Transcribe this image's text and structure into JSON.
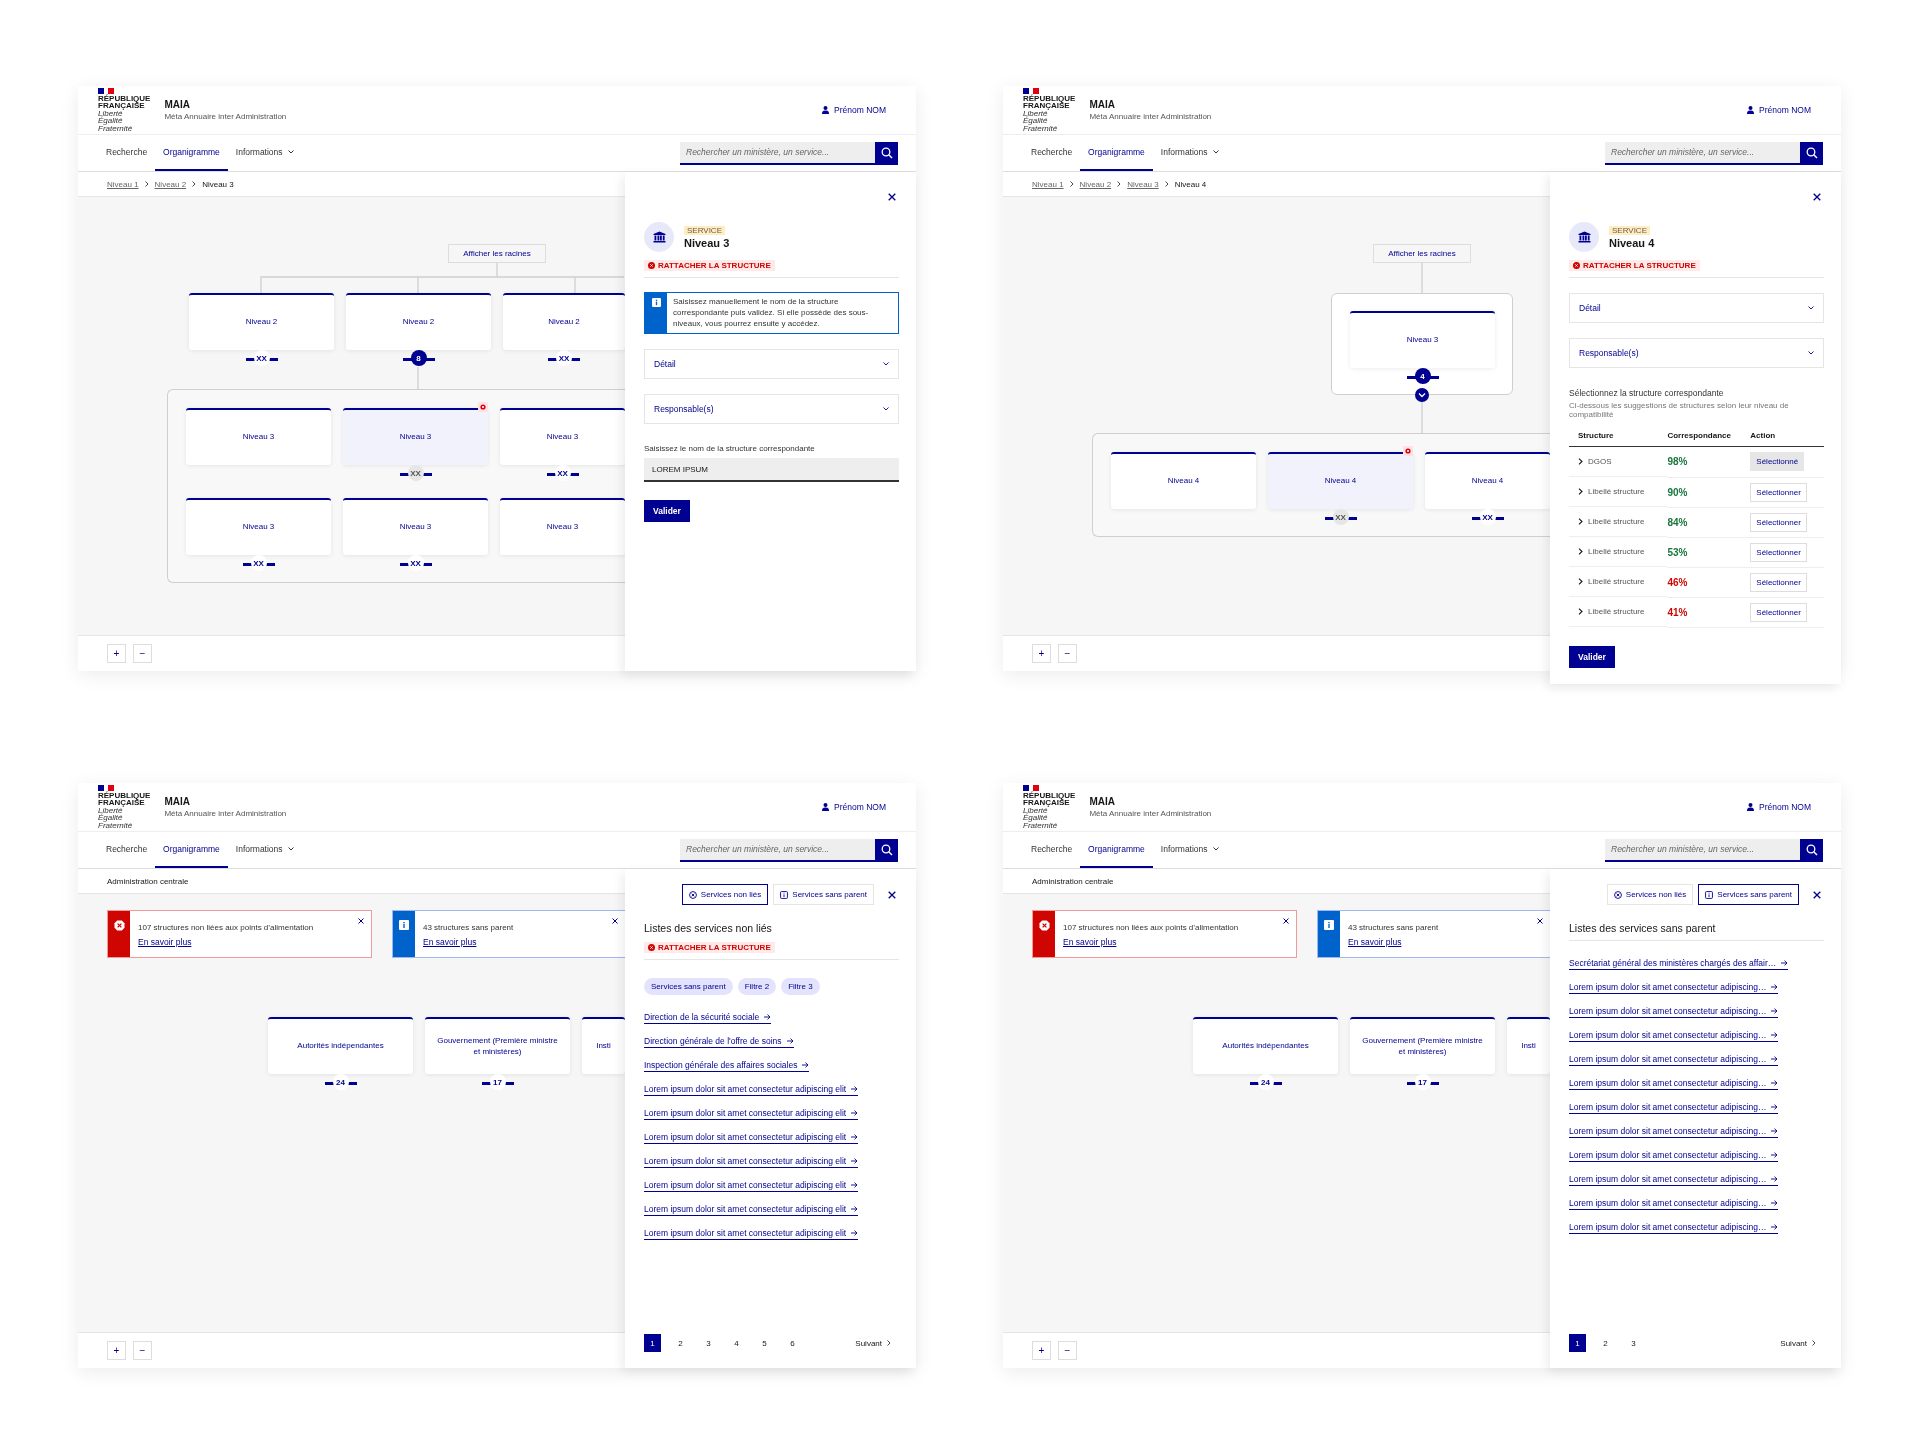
{
  "screens": [
    {
      "header": {
        "logo": [
          "RÉPUBLIQUE",
          "FRANÇAISE"
        ],
        "motto": [
          "Liberté",
          "Égalité",
          "Fraternité"
        ],
        "brand": "MAIA",
        "tagline": "Méta Annuaire inter Administration",
        "user": "Prénom NOM"
      },
      "nav": [
        {
          "label": "Recherche",
          "selected": false
        },
        {
          "label": "Organigramme",
          "selected": true
        },
        {
          "label": "Informations",
          "selected": false,
          "menu": true
        }
      ],
      "search": {
        "placeholder": "Rechercher un ministère, un service..."
      },
      "breadcrumb": [
        {
          "label": "Niveau 1",
          "current": false
        },
        {
          "label": "Niveau 2",
          "current": false
        },
        {
          "label": "Niveau 3",
          "current": true
        }
      ],
      "canvas": {
        "kind": "tree",
        "roots_button": "Afficher les racines",
        "parents": [
          {
            "label": "Niveau 2",
            "count": "XX",
            "expanded": false,
            "selected": false,
            "alert": false
          },
          {
            "label": "Niveau 2",
            "count": "8",
            "expanded": true,
            "selected": false,
            "alert": false
          },
          {
            "label": "Niveau 2",
            "count": "XX",
            "expanded": false,
            "selected": false,
            "alert": false
          }
        ],
        "children": [
          [
            {
              "label": "Niveau 3",
              "selected": false,
              "alert": false
            },
            {
              "label": "Niveau 3",
              "count": "XX",
              "expanded": false,
              "selected": true,
              "alert": true
            },
            {
              "label": "Niveau 3",
              "count": "XX",
              "expanded": false,
              "selected": false,
              "alert": false
            }
          ],
          [
            {
              "label": "Niveau 3",
              "count": "XX",
              "expanded": false,
              "selected": false,
              "alert": false
            },
            {
              "label": "Niveau 3",
              "count": "XX",
              "expanded": false,
              "selected": false,
              "alert": false
            },
            {
              "label": "Niveau 3",
              "selected": false,
              "alert": false
            }
          ]
        ]
      },
      "zoom_controls": [
        "+",
        "−"
      ],
      "panel": {
        "kind": "structure",
        "tag": "SERVICE",
        "title": "Niveau 3",
        "status": "RATTACHER LA STRUCTURE",
        "callout": "Saisissez manuellement le nom de la structure correspondante puis validez. Si elle possède des sous-niveaux, vous pourrez ensuite y accédez.",
        "accordions": [
          {
            "label": "Détail",
            "expanded": false
          },
          {
            "label": "Responsable(s)",
            "expanded": false
          }
        ],
        "field": {
          "label": "Saisissez le nom de la structure correspondante",
          "value": "LOREM IPSUM"
        },
        "submit": "Valider"
      }
    },
    {
      "header": {
        "logo": [
          "RÉPUBLIQUE",
          "FRANÇAISE"
        ],
        "motto": [
          "Liberté",
          "Égalité",
          "Fraternité"
        ],
        "brand": "MAIA",
        "tagline": "Méta Annuaire inter Administration",
        "user": "Prénom NOM"
      },
      "nav": [
        {
          "label": "Recherche",
          "selected": false
        },
        {
          "label": "Organigramme",
          "selected": true
        },
        {
          "label": "Informations",
          "selected": false,
          "menu": true
        }
      ],
      "search": {
        "placeholder": "Rechercher un ministère, un service..."
      },
      "breadcrumb": [
        {
          "label": "Niveau 1",
          "current": false
        },
        {
          "label": "Niveau 2",
          "current": false
        },
        {
          "label": "Niveau 3",
          "current": false
        },
        {
          "label": "Niveau 4",
          "current": true
        }
      ],
      "canvas": {
        "kind": "focus",
        "roots_button": "Afficher les racines",
        "parents": [
          {
            "label": "Niveau 3",
            "count": "4",
            "expanded": true,
            "selected": false,
            "alert": false
          }
        ],
        "children": [
          [
            {
              "label": "Niveau 4",
              "selected": false,
              "alert": false
            },
            {
              "label": "Niveau 4",
              "count": "XX",
              "expanded": false,
              "selected": true,
              "alert": true
            },
            {
              "label": "Niveau 4",
              "count": "XX",
              "expanded": false,
              "selected": false,
              "alert": false
            }
          ]
        ]
      },
      "zoom_controls": [
        "+",
        "−"
      ],
      "panel": {
        "kind": "structure",
        "tag": "SERVICE",
        "title": "Niveau 4",
        "status": "RATTACHER LA STRUCTURE",
        "accordions": [
          {
            "label": "Détail",
            "expanded": false
          },
          {
            "label": "Responsable(s)",
            "expanded": false
          }
        ],
        "chooser": {
          "title": "Sélectionnez la structure correspondante",
          "hint": "Ci-dessous les suggestions de structures selon leur niveau de compatibilité",
          "columns": [
            "Structure",
            "Correspondance",
            "Action"
          ],
          "rows": [
            {
              "name": "DGOS",
              "match": "98%",
              "color": "#18753c",
              "action": "Sélectionné",
              "selected": true
            },
            {
              "name": "Libellé structure",
              "match": "90%",
              "color": "#18753c",
              "action": "Sélectionner",
              "selected": false
            },
            {
              "name": "Libellé structure",
              "match": "84%",
              "color": "#18753c",
              "action": "Sélectionner",
              "selected": false
            },
            {
              "name": "Libellé structure",
              "match": "53%",
              "color": "#18753c",
              "action": "Sélectionner",
              "selected": false
            },
            {
              "name": "Libellé structure",
              "match": "46%",
              "color": "#ce0500",
              "action": "Sélectionner",
              "selected": false
            },
            {
              "name": "Libellé structure",
              "match": "41%",
              "color": "#ce0500",
              "action": "Sélectionner",
              "selected": false
            }
          ]
        },
        "submit": "Valider"
      }
    },
    {
      "header": {
        "logo": [
          "RÉPUBLIQUE",
          "FRANÇAISE"
        ],
        "motto": [
          "Liberté",
          "Égalité",
          "Fraternité"
        ],
        "brand": "MAIA",
        "tagline": "Méta Annuaire inter Administration",
        "user": "Prénom NOM"
      },
      "nav": [
        {
          "label": "Recherche",
          "selected": false
        },
        {
          "label": "Organigramme",
          "selected": true
        },
        {
          "label": "Informations",
          "selected": false,
          "menu": true
        }
      ],
      "search": {
        "placeholder": "Rechercher un ministère, un service..."
      },
      "breadcrumb": [
        {
          "label": "Administration centrale",
          "current": true
        }
      ],
      "canvas": {
        "kind": "overview",
        "alerts": [
          {
            "kind": "error",
            "text": "107 structures non liées aux points d’alimentation",
            "link": "En savoir plus"
          },
          {
            "kind": "info",
            "text": "43 structures sans parent",
            "link": "En savoir plus"
          }
        ],
        "nodes": [
          {
            "label": "Autorités indépendantes",
            "count": "24",
            "expanded": false,
            "selected": false,
            "alert": false
          },
          {
            "label": "Gouvernement (Première ministre et ministères)",
            "count": "17",
            "expanded": false,
            "selected": false,
            "alert": false
          },
          {
            "label": "Insti",
            "selected": false,
            "alert": false
          }
        ]
      },
      "zoom_controls": [
        "+",
        "−"
      ],
      "panel": {
        "kind": "list",
        "tabs": [
          {
            "label": "Services non liés",
            "selected": true
          },
          {
            "label": "Services sans parent",
            "selected": false
          }
        ],
        "title": "Listes des services non liés",
        "status": "RATTACHER LA STRUCTURE",
        "chips": [
          "Services sans parent",
          "Filtre 2",
          "Filtre 3"
        ],
        "links": [
          "Direction de la sécurité sociale",
          "Direction générale de l'offre de soins",
          "Inspection générale des affaires sociales",
          "Lorem ipsum dolor sit amet consectetur adipiscing elit",
          "Lorem ipsum dolor sit amet consectetur adipiscing elit",
          "Lorem ipsum dolor sit amet consectetur adipiscing elit",
          "Lorem ipsum dolor sit amet consectetur adipiscing elit",
          "Lorem ipsum dolor sit amet consectetur adipiscing elit",
          "Lorem ipsum dolor sit amet consectetur adipiscing elit",
          "Lorem ipsum dolor sit amet consectetur adipiscing elit"
        ],
        "pages": [
          {
            "label": "1",
            "selected": true
          },
          {
            "label": "2",
            "selected": false
          },
          {
            "label": "3",
            "selected": false
          },
          {
            "label": "4",
            "selected": false
          },
          {
            "label": "5",
            "selected": false
          },
          {
            "label": "6",
            "selected": false
          }
        ],
        "next": "Suivant"
      }
    },
    {
      "header": {
        "logo": [
          "RÉPUBLIQUE",
          "FRANÇAISE"
        ],
        "motto": [
          "Liberté",
          "Égalité",
          "Fraternité"
        ],
        "brand": "MAIA",
        "tagline": "Méta Annuaire inter Administration",
        "user": "Prénom NOM"
      },
      "nav": [
        {
          "label": "Recherche",
          "selected": false
        },
        {
          "label": "Organigramme",
          "selected": true
        },
        {
          "label": "Informations",
          "selected": false,
          "menu": true
        }
      ],
      "search": {
        "placeholder": "Rechercher un ministère, un service..."
      },
      "breadcrumb": [
        {
          "label": "Administration centrale",
          "current": true
        }
      ],
      "canvas": {
        "kind": "overview",
        "alerts": [
          {
            "kind": "error",
            "text": "107 structures non liées aux points d’alimentation",
            "link": "En savoir plus"
          },
          {
            "kind": "info",
            "text": "43 structures sans parent",
            "link": "En savoir plus"
          }
        ],
        "nodes": [
          {
            "label": "Autorités indépendantes",
            "count": "24",
            "expanded": false,
            "selected": false,
            "alert": false
          },
          {
            "label": "Gouvernement (Première ministre et ministères)",
            "count": "17",
            "expanded": false,
            "selected": false,
            "alert": false
          },
          {
            "label": "Insti",
            "selected": false,
            "alert": false
          }
        ]
      },
      "zoom_controls": [
        "+",
        "−"
      ],
      "panel": {
        "kind": "list",
        "tabs": [
          {
            "label": "Services non liés",
            "selected": false
          },
          {
            "label": "Services sans parent",
            "selected": true
          }
        ],
        "title": "Listes des services sans parent",
        "links": [
          "Secrétariat général des ministères chargés des affair…",
          "Lorem ipsum dolor sit amet consectetur adipiscing…",
          "Lorem ipsum dolor sit amet consectetur adipiscing…",
          "Lorem ipsum dolor sit amet consectetur adipiscing…",
          "Lorem ipsum dolor sit amet consectetur adipiscing…",
          "Lorem ipsum dolor sit amet consectetur adipiscing…",
          "Lorem ipsum dolor sit amet consectetur adipiscing…",
          "Lorem ipsum dolor sit amet consectetur adipiscing…",
          "Lorem ipsum dolor sit amet consectetur adipiscing…",
          "Lorem ipsum dolor sit amet consectetur adipiscing…",
          "Lorem ipsum dolor sit amet consectetur adipiscing…",
          "Lorem ipsum dolor sit amet consectetur adipiscing…"
        ],
        "pages": [
          {
            "label": "1",
            "selected": true
          },
          {
            "label": "2",
            "selected": false
          },
          {
            "label": "3",
            "selected": false
          }
        ],
        "next": "Suivant"
      }
    }
  ]
}
